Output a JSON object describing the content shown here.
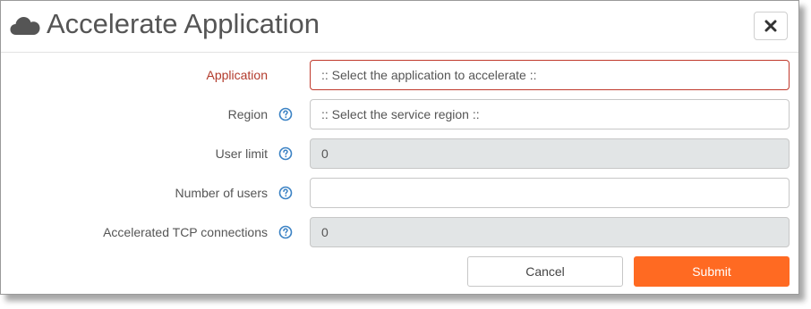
{
  "dialog": {
    "title": "Accelerate Application",
    "icon": "cloud-icon",
    "close_icon": "close-icon"
  },
  "form": {
    "application": {
      "label": "Application",
      "placeholder": ":: Select the application to accelerate ::"
    },
    "region": {
      "label": "Region",
      "placeholder": ":: Select the service region ::",
      "help_icon": "help-icon"
    },
    "user_limit": {
      "label": "User limit",
      "value": "0",
      "help_icon": "help-icon"
    },
    "number_of_users": {
      "label": "Number of users",
      "value": "",
      "help_icon": "help-icon"
    },
    "accelerated_tcp": {
      "label": "Accelerated TCP connections",
      "value": "0",
      "help_icon": "help-icon"
    }
  },
  "buttons": {
    "cancel": "Cancel",
    "submit": "Submit"
  },
  "colors": {
    "accent": "#ff6a22",
    "required_label": "#b23a2b",
    "help_icon": "#3b82c4"
  }
}
